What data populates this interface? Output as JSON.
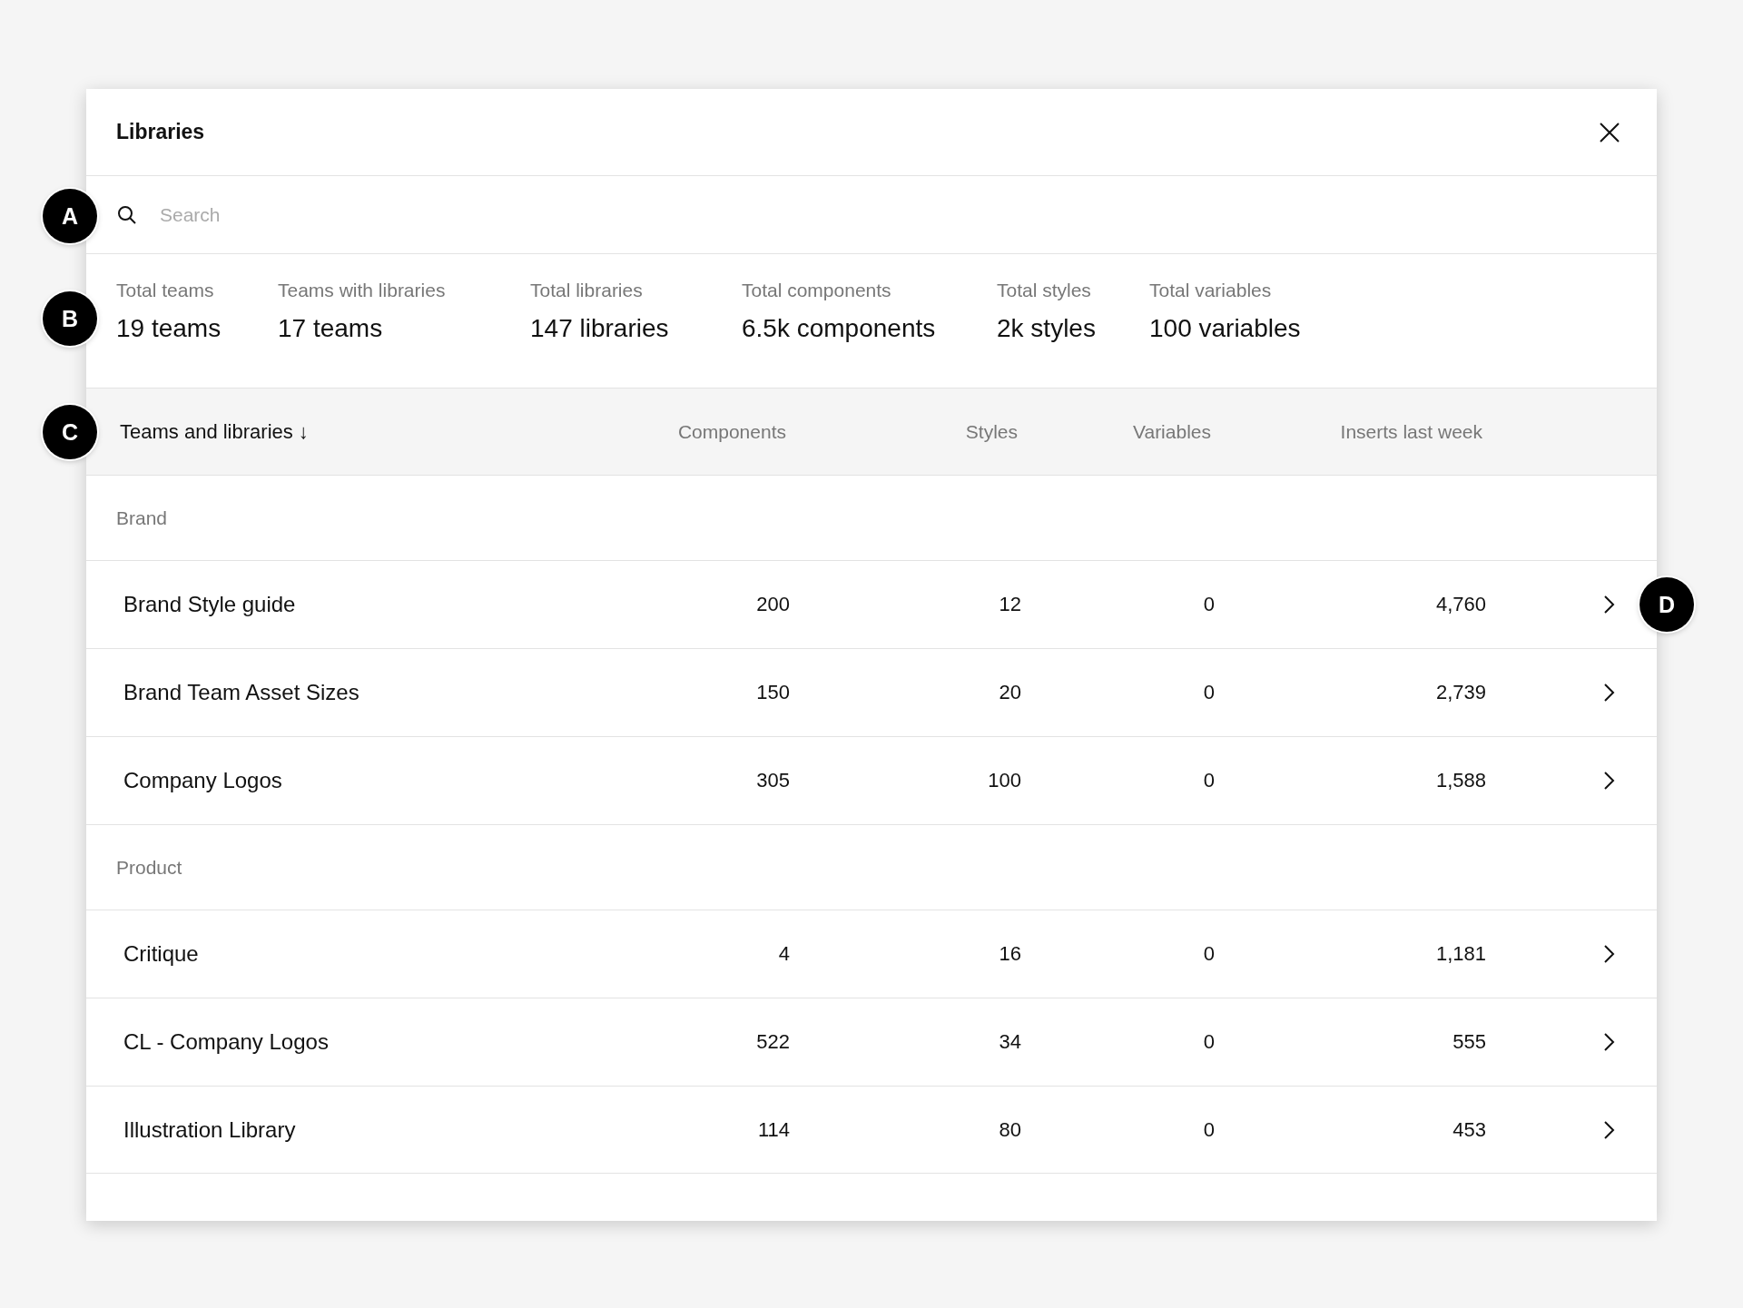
{
  "dialog": {
    "title": "Libraries"
  },
  "search": {
    "placeholder": "Search"
  },
  "stats": [
    {
      "label": "Total teams",
      "value": "19 teams"
    },
    {
      "label": "Teams with libraries",
      "value": "17 teams"
    },
    {
      "label": "Total libraries",
      "value": "147 libraries"
    },
    {
      "label": "Total components",
      "value": "6.5k components"
    },
    {
      "label": "Total styles",
      "value": "2k styles"
    },
    {
      "label": "Total variables",
      "value": "100 variables"
    }
  ],
  "table": {
    "columns": [
      "Teams and libraries",
      "Components",
      "Styles",
      "Variables",
      "Inserts last week"
    ],
    "sort_indicator": "↓",
    "groups": [
      {
        "name": "Brand",
        "rows": [
          {
            "cells": [
              "Brand Style guide",
              "200",
              "12",
              "0",
              "4,760"
            ]
          },
          {
            "cells": [
              "Brand Team Asset Sizes",
              "150",
              "20",
              "0",
              "2,739"
            ]
          },
          {
            "cells": [
              "Company Logos",
              "305",
              "100",
              "0",
              "1,588"
            ]
          }
        ]
      },
      {
        "name": "Product",
        "rows": [
          {
            "cells": [
              "Critique",
              "4",
              "16",
              "0",
              "1,181"
            ]
          },
          {
            "cells": [
              "CL - Company Logos",
              "522",
              "34",
              "0",
              "555"
            ]
          },
          {
            "cells": [
              "Illustration Library",
              "114",
              "80",
              "0",
              "453"
            ]
          }
        ]
      }
    ]
  },
  "markers": [
    "A",
    "B",
    "C",
    "D"
  ]
}
